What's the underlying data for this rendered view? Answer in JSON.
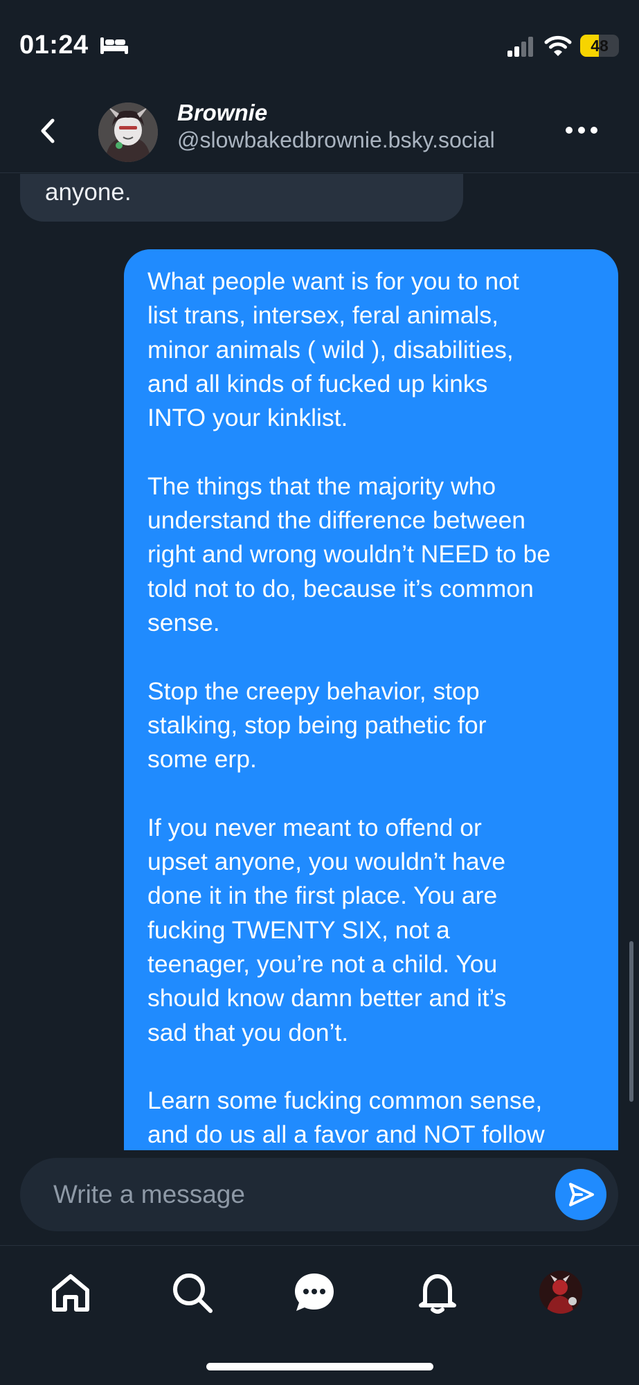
{
  "status_bar": {
    "time": "01:24",
    "battery": "48",
    "icons": [
      "bed-icon",
      "cellular-signal-icon",
      "wifi-icon",
      "battery-icon"
    ]
  },
  "header": {
    "name": "Brownie",
    "handle": "@slowbakedbrownie.bsky.social",
    "icons": [
      "back-chevron-icon",
      "more-options-icon"
    ]
  },
  "messages": {
    "incoming_partial": "anyone.",
    "outgoing": [
      "What people want is for you to not\nlist trans, intersex, feral animals,\nminor animals ( wild ), disabilities,\nand all kinds of fucked up kinks\nINTO your kinklist.",
      "The things that the majority who\nunderstand the difference between\nright and wrong wouldn’t NEED to be\ntold not to do, because it’s common\nsense.",
      "Stop the creepy behavior, stop\nstalking, stop being pathetic for\nsome erp.",
      "If you never meant to offend or\nupset anyone, you wouldn’t have\ndone it in the first place. You are\nfucking TWENTY SIX, not a\nteenager, you’re not a child. You\nshould know damn better and it’s\nsad that you don’t.",
      "Learn some fucking common sense,\nand do us all a favor and NOT follow"
    ]
  },
  "compose": {
    "placeholder": "Write a message",
    "icons": [
      "send-icon"
    ]
  },
  "nav": {
    "icons": [
      "home-icon",
      "search-icon",
      "chat-icon",
      "notifications-bell-icon",
      "profile-avatar"
    ]
  },
  "colors": {
    "background": "#161e27",
    "outgoing_bubble": "#208bfe",
    "incoming_bubble": "#28323f",
    "accent": "#208bfe",
    "battery": "#f7d400"
  }
}
